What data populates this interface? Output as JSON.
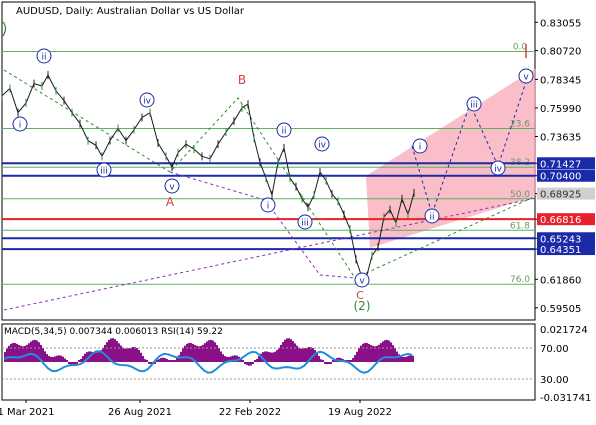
{
  "window": {
    "title": "AUDUSD, Daily:  Australian Dollar vs US Dollar"
  },
  "chart_data": [
    {
      "type": "line",
      "title": "AUDUSD, Daily:  Australian Dollar vs US Dollar",
      "x_tick_labels": [
        "1 Mar 2021",
        "26 Aug 2021",
        "22 Feb 2022",
        "19 Aug 2022"
      ],
      "y_range": [
        0.585,
        0.844
      ],
      "y_tick_labels": [
        "0.83055",
        "0.80720",
        "0.78345",
        "0.75990",
        "0.73635",
        "0.71427",
        "0.70400",
        "0.68925",
        "0.66816",
        "0.65243",
        "0.64351",
        "0.61860",
        "0.59505"
      ],
      "highlighted_levels": [
        {
          "label": "0.71427",
          "color": "#1a2aa8"
        },
        {
          "label": "0.70400",
          "color": "#1a2aa8"
        },
        {
          "label": "0.66816",
          "color": "#e8202a"
        },
        {
          "label": "0.65243",
          "color": "#1a2aa8"
        },
        {
          "label": "0.64351",
          "color": "#1a2aa8"
        }
      ],
      "fibonacci_levels": [
        {
          "label": "0.0",
          "value": 0.8065
        },
        {
          "label": "23.6",
          "value": 0.743
        },
        {
          "label": "38.2",
          "value": 0.711
        },
        {
          "label": "50.0",
          "value": 0.685
        },
        {
          "label": "61.8",
          "value": 0.659
        },
        {
          "label": "76.0",
          "value": 0.6145
        }
      ],
      "price_series": [
        {
          "x": 0,
          "y": 0.77
        },
        {
          "x": 8,
          "y": 0.776
        },
        {
          "x": 16,
          "y": 0.756
        },
        {
          "x": 24,
          "y": 0.764
        },
        {
          "x": 32,
          "y": 0.78
        },
        {
          "x": 40,
          "y": 0.778
        },
        {
          "x": 46,
          "y": 0.787
        },
        {
          "x": 54,
          "y": 0.774
        },
        {
          "x": 62,
          "y": 0.766
        },
        {
          "x": 70,
          "y": 0.756
        },
        {
          "x": 78,
          "y": 0.747
        },
        {
          "x": 86,
          "y": 0.733
        },
        {
          "x": 94,
          "y": 0.729
        },
        {
          "x": 100,
          "y": 0.72
        },
        {
          "x": 108,
          "y": 0.733
        },
        {
          "x": 116,
          "y": 0.743
        },
        {
          "x": 124,
          "y": 0.733
        },
        {
          "x": 132,
          "y": 0.742
        },
        {
          "x": 140,
          "y": 0.752
        },
        {
          "x": 148,
          "y": 0.756
        },
        {
          "x": 156,
          "y": 0.731
        },
        {
          "x": 164,
          "y": 0.72
        },
        {
          "x": 170,
          "y": 0.711
        },
        {
          "x": 176,
          "y": 0.723
        },
        {
          "x": 184,
          "y": 0.73
        },
        {
          "x": 192,
          "y": 0.726
        },
        {
          "x": 200,
          "y": 0.72
        },
        {
          "x": 208,
          "y": 0.718
        },
        {
          "x": 216,
          "y": 0.73
        },
        {
          "x": 224,
          "y": 0.74
        },
        {
          "x": 232,
          "y": 0.749
        },
        {
          "x": 240,
          "y": 0.76
        },
        {
          "x": 246,
          "y": 0.763
        },
        {
          "x": 252,
          "y": 0.735
        },
        {
          "x": 258,
          "y": 0.715
        },
        {
          "x": 264,
          "y": 0.702
        },
        {
          "x": 270,
          "y": 0.688
        },
        {
          "x": 276,
          "y": 0.715
        },
        {
          "x": 282,
          "y": 0.727
        },
        {
          "x": 288,
          "y": 0.702
        },
        {
          "x": 294,
          "y": 0.695
        },
        {
          "x": 300,
          "y": 0.685
        },
        {
          "x": 306,
          "y": 0.678
        },
        {
          "x": 312,
          "y": 0.688
        },
        {
          "x": 318,
          "y": 0.707
        },
        {
          "x": 324,
          "y": 0.7
        },
        {
          "x": 330,
          "y": 0.689
        },
        {
          "x": 336,
          "y": 0.683
        },
        {
          "x": 342,
          "y": 0.672
        },
        {
          "x": 348,
          "y": 0.66
        },
        {
          "x": 354,
          "y": 0.635
        },
        {
          "x": 360,
          "y": 0.62
        },
        {
          "x": 364,
          "y": 0.619
        },
        {
          "x": 370,
          "y": 0.638
        },
        {
          "x": 376,
          "y": 0.645
        },
        {
          "x": 382,
          "y": 0.67
        },
        {
          "x": 388,
          "y": 0.676
        },
        {
          "x": 394,
          "y": 0.665
        },
        {
          "x": 400,
          "y": 0.685
        },
        {
          "x": 406,
          "y": 0.672
        },
        {
          "x": 412,
          "y": 0.69
        }
      ],
      "current_price_label": "0.68925",
      "wave_labels": [
        "(i)",
        "(ii)",
        "(iii)",
        "(iv)",
        "(v)",
        "B",
        "A",
        "C",
        "(2)"
      ],
      "forecast_wave_labels": [
        "(i)",
        "(ii)",
        "(iii)",
        "(iv)",
        "(v)"
      ]
    },
    {
      "type": "bar",
      "title": "MACD(5,34,5) 0.007344 0.006013 RSI(14) 59.22",
      "y_tick_labels": [
        "0.021724",
        "70.00",
        "30.00",
        "-0.031741"
      ],
      "indicator_bands": [
        {
          "name": "MACD",
          "color": "#8b0f86"
        },
        {
          "name": "RSI",
          "color": "#1f8fdb"
        }
      ]
    }
  ]
}
